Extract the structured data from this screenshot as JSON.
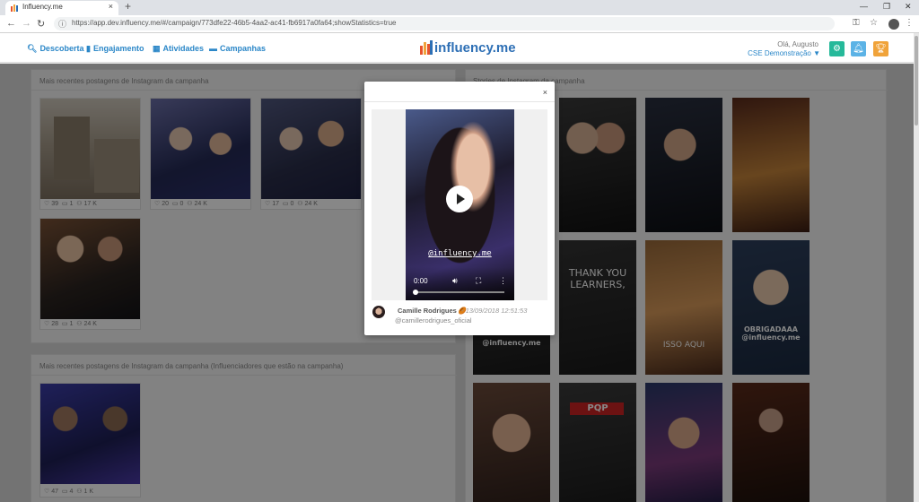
{
  "browser": {
    "tab_title": "Influency.me",
    "url": "https://app.dev.influency.me/#/campaign/773dfe22-46b5-4aa2-ac41-fb6917a0fa64;showStatistics=true"
  },
  "header": {
    "nav": [
      "Descoberta",
      "Engajamento",
      "Atividades",
      "Campanhas"
    ],
    "logo_text": "influency.me",
    "greeting": "Olá, Augusto",
    "org": "CSE Demonstração ▼",
    "colors": {
      "settings": "#26b99a",
      "bell": "#5cb3e6",
      "trophy": "#f0a33a",
      "link": "#2b87c8"
    }
  },
  "left_section": {
    "title": "Mais recentes postagens de Instagram da campanha",
    "posts": [
      {
        "likes": "39",
        "comments": "1",
        "reach": "17 K"
      },
      {
        "likes": "20",
        "comments": "0",
        "reach": "24 K"
      },
      {
        "likes": "17",
        "comments": "0",
        "reach": "24 K"
      },
      {
        "likes": "28",
        "comments": "1",
        "reach": "24 K"
      }
    ]
  },
  "left_section2": {
    "title": "Mais recentes postagens de Instagram da campanha (Influenciadores que estão na campanha)",
    "posts": [
      {
        "likes": "47",
        "comments": "4",
        "reach": "1 K"
      }
    ]
  },
  "right_section": {
    "title": "Stories de Instagram da campanha",
    "story_texts": [
      "@influency.me",
      "THANK YOU LEARNERS,",
      "ISSO AQUI",
      "OBRIGADAAA @influency.me",
      "PQP"
    ]
  },
  "modal": {
    "close": "×",
    "video_handle": "@influency.me",
    "video_time": "0:00",
    "author_name": "Camille Rodrigues 🏉",
    "date": "- 13/09/2018 12:51:53",
    "handle": "@camillerodrigues_oficial"
  }
}
